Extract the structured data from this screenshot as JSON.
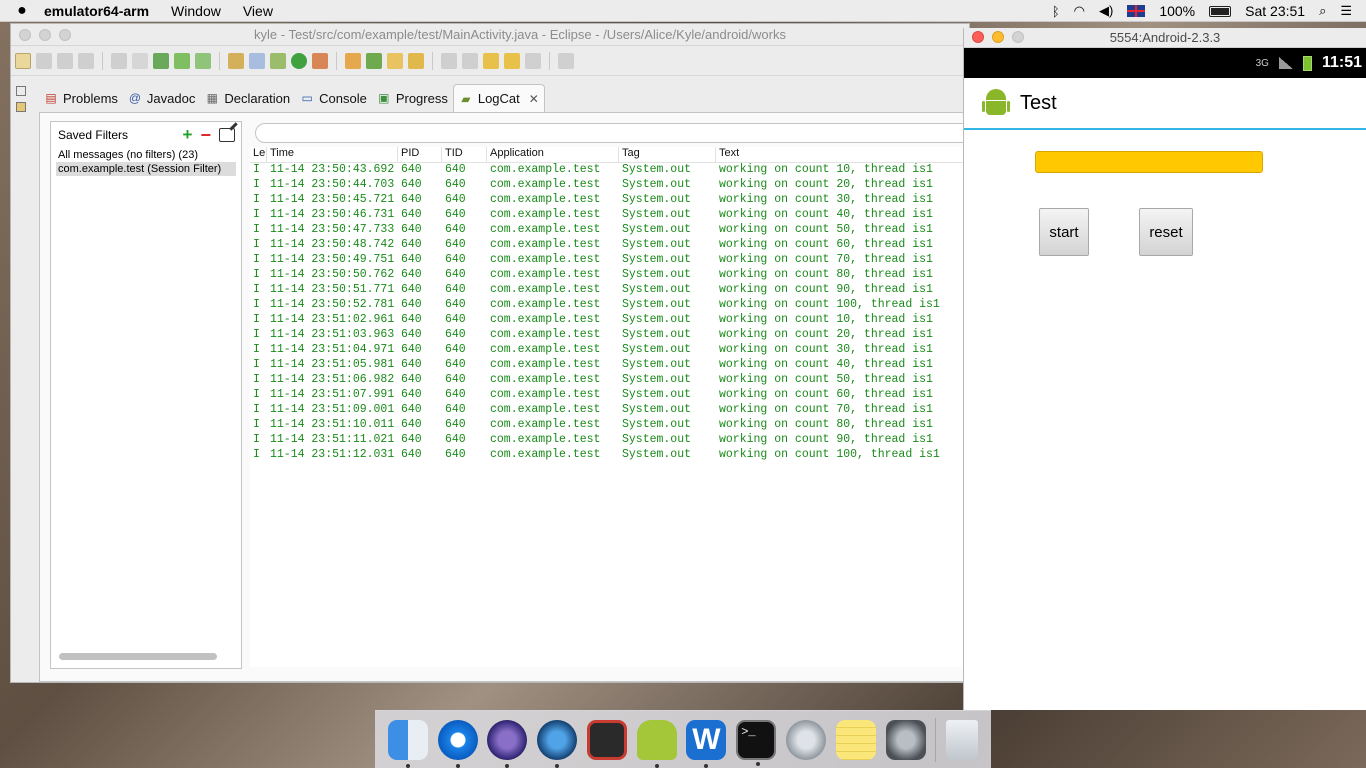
{
  "menubar": {
    "app_name": "emulator64-arm",
    "menus": [
      "Window",
      "View"
    ],
    "battery": "100%",
    "clock": "Sat 23:51"
  },
  "eclipse": {
    "title": "kyle - Test/src/com/example/test/MainActivity.java - Eclipse - /Users/Alice/Kyle/android/works",
    "tabs": [
      {
        "label": "Problems",
        "icon": "problems-icon"
      },
      {
        "label": "Javadoc",
        "icon": "javadoc-icon"
      },
      {
        "label": "Declaration",
        "icon": "declaration-icon"
      },
      {
        "label": "Console",
        "icon": "console-icon"
      },
      {
        "label": "Progress",
        "icon": "progress-icon"
      },
      {
        "label": "LogCat",
        "icon": "logcat-icon"
      }
    ],
    "saved_filters": {
      "title": "Saved Filters",
      "items": [
        "All messages (no filters) (23)",
        "com.example.test (Session Filter)"
      ]
    },
    "logcat": {
      "search_placeholder": "",
      "columns": [
        "Le",
        "Time",
        "PID",
        "TID",
        "Application",
        "Tag",
        "Text"
      ],
      "rows": [
        [
          "I",
          "11-14 23:50:43.692",
          "640",
          "640",
          "com.example.test",
          "System.out",
          "working on count 10, thread is1"
        ],
        [
          "I",
          "11-14 23:50:44.703",
          "640",
          "640",
          "com.example.test",
          "System.out",
          "working on count 20, thread is1"
        ],
        [
          "I",
          "11-14 23:50:45.721",
          "640",
          "640",
          "com.example.test",
          "System.out",
          "working on count 30, thread is1"
        ],
        [
          "I",
          "11-14 23:50:46.731",
          "640",
          "640",
          "com.example.test",
          "System.out",
          "working on count 40, thread is1"
        ],
        [
          "I",
          "11-14 23:50:47.733",
          "640",
          "640",
          "com.example.test",
          "System.out",
          "working on count 50, thread is1"
        ],
        [
          "I",
          "11-14 23:50:48.742",
          "640",
          "640",
          "com.example.test",
          "System.out",
          "working on count 60, thread is1"
        ],
        [
          "I",
          "11-14 23:50:49.751",
          "640",
          "640",
          "com.example.test",
          "System.out",
          "working on count 70, thread is1"
        ],
        [
          "I",
          "11-14 23:50:50.762",
          "640",
          "640",
          "com.example.test",
          "System.out",
          "working on count 80, thread is1"
        ],
        [
          "I",
          "11-14 23:50:51.771",
          "640",
          "640",
          "com.example.test",
          "System.out",
          "working on count 90, thread is1"
        ],
        [
          "I",
          "11-14 23:50:52.781",
          "640",
          "640",
          "com.example.test",
          "System.out",
          "working on count 100, thread is1"
        ],
        [
          "I",
          "11-14 23:51:02.961",
          "640",
          "640",
          "com.example.test",
          "System.out",
          "working on count 10, thread is1"
        ],
        [
          "I",
          "11-14 23:51:03.963",
          "640",
          "640",
          "com.example.test",
          "System.out",
          "working on count 20, thread is1"
        ],
        [
          "I",
          "11-14 23:51:04.971",
          "640",
          "640",
          "com.example.test",
          "System.out",
          "working on count 30, thread is1"
        ],
        [
          "I",
          "11-14 23:51:05.981",
          "640",
          "640",
          "com.example.test",
          "System.out",
          "working on count 40, thread is1"
        ],
        [
          "I",
          "11-14 23:51:06.982",
          "640",
          "640",
          "com.example.test",
          "System.out",
          "working on count 50, thread is1"
        ],
        [
          "I",
          "11-14 23:51:07.991",
          "640",
          "640",
          "com.example.test",
          "System.out",
          "working on count 60, thread is1"
        ],
        [
          "I",
          "11-14 23:51:09.001",
          "640",
          "640",
          "com.example.test",
          "System.out",
          "working on count 70, thread is1"
        ],
        [
          "I",
          "11-14 23:51:10.011",
          "640",
          "640",
          "com.example.test",
          "System.out",
          "working on count 80, thread is1"
        ],
        [
          "I",
          "11-14 23:51:11.021",
          "640",
          "640",
          "com.example.test",
          "System.out",
          "working on count 90, thread is1"
        ],
        [
          "I",
          "11-14 23:51:12.031",
          "640",
          "640",
          "com.example.test",
          "System.out",
          "working on count 100, thread is1"
        ]
      ]
    }
  },
  "emulator": {
    "title": "5554:Android-2.3.3",
    "status_time": "11:51",
    "app_title": "Test",
    "progress": 1.0,
    "start_label": "start",
    "reset_label": "reset"
  },
  "dock": {
    "apps": [
      "finder-icon",
      "safari-icon",
      "eclipse-icon",
      "quicktime-icon",
      "photo-booth-icon",
      "android-icon",
      "word-icon",
      "terminal-icon",
      "launchpad-icon",
      "notes-icon",
      "system-preferences-icon",
      "trash-icon"
    ]
  },
  "colors": {
    "log_text": "#1a8a1a",
    "progress_fill": "#ffc800",
    "android_accent": "#33b5e5"
  }
}
